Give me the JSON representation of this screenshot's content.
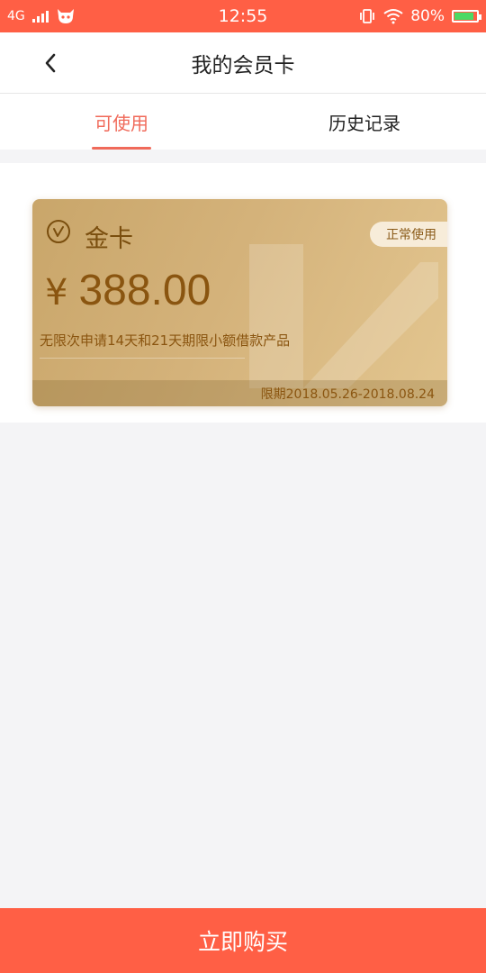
{
  "status_bar": {
    "network": "4G",
    "time": "12:55",
    "battery": "80%"
  },
  "header": {
    "title": "我的会员卡"
  },
  "tabs": [
    {
      "label": "可使用",
      "active": true
    },
    {
      "label": "历史记录",
      "active": false
    }
  ],
  "card": {
    "name": "金卡",
    "status": "正常使用",
    "currency": "¥",
    "price": "388.00",
    "description": "无限次申请14天和21天期限小额借款产品",
    "validity": "限期2018.05.26-2018.08.24"
  },
  "footer": {
    "buy_label": "立即购买"
  },
  "colors": {
    "accent": "#ff5f45",
    "tab_active": "#f06a5a",
    "card_text": "#8a5510"
  }
}
